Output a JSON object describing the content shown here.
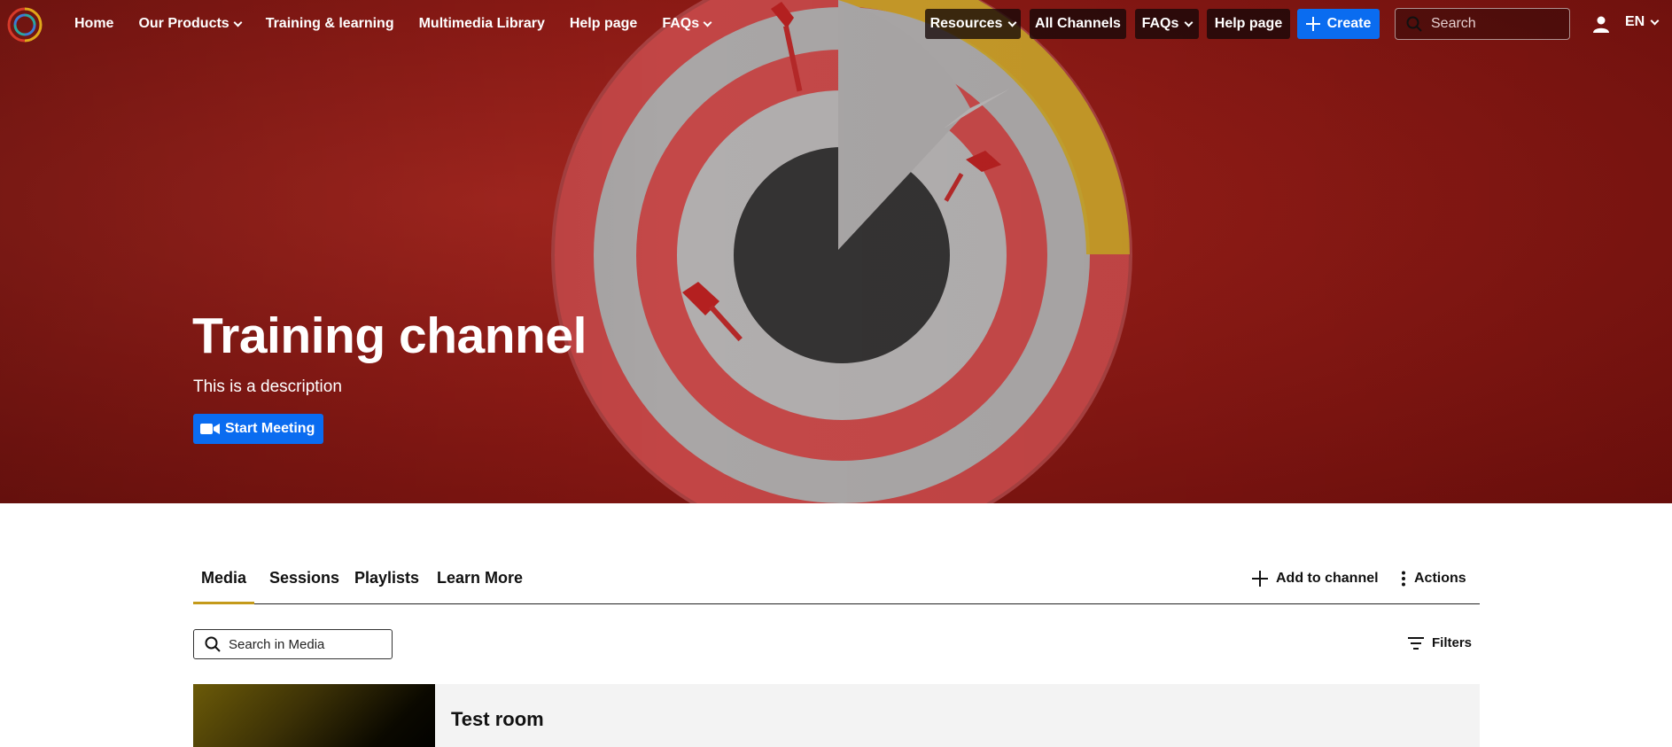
{
  "nav": {
    "logo_icon": "logo-circle-icon",
    "links": [
      {
        "label": "Home"
      },
      {
        "label": "Our Products",
        "dropdown": true
      },
      {
        "label": "Training & learning"
      },
      {
        "label": "Multimedia Library"
      },
      {
        "label": "Help page"
      },
      {
        "label": "FAQs",
        "dropdown": true
      }
    ],
    "right": {
      "resources": "Resources",
      "all_channels": "All Channels",
      "faqs": "FAQs",
      "help": "Help page",
      "create": "Create",
      "search_placeholder": "Search",
      "language": "EN"
    }
  },
  "hero": {
    "title": "Training channel",
    "description": "This is a description",
    "start_meeting": "Start Meeting"
  },
  "tabs": {
    "items": [
      "Media",
      "Sessions",
      "Playlists",
      "Learn More"
    ],
    "active": "Media",
    "add_to_channel": "Add to channel",
    "actions": "Actions"
  },
  "media": {
    "search_placeholder": "Search in Media",
    "filters": "Filters",
    "entries": [
      {
        "title": "Test room"
      }
    ]
  },
  "colors": {
    "primary": "#0a6cf0",
    "hero_red": "#8c1a15",
    "tab_underline": "#c49a1a"
  }
}
